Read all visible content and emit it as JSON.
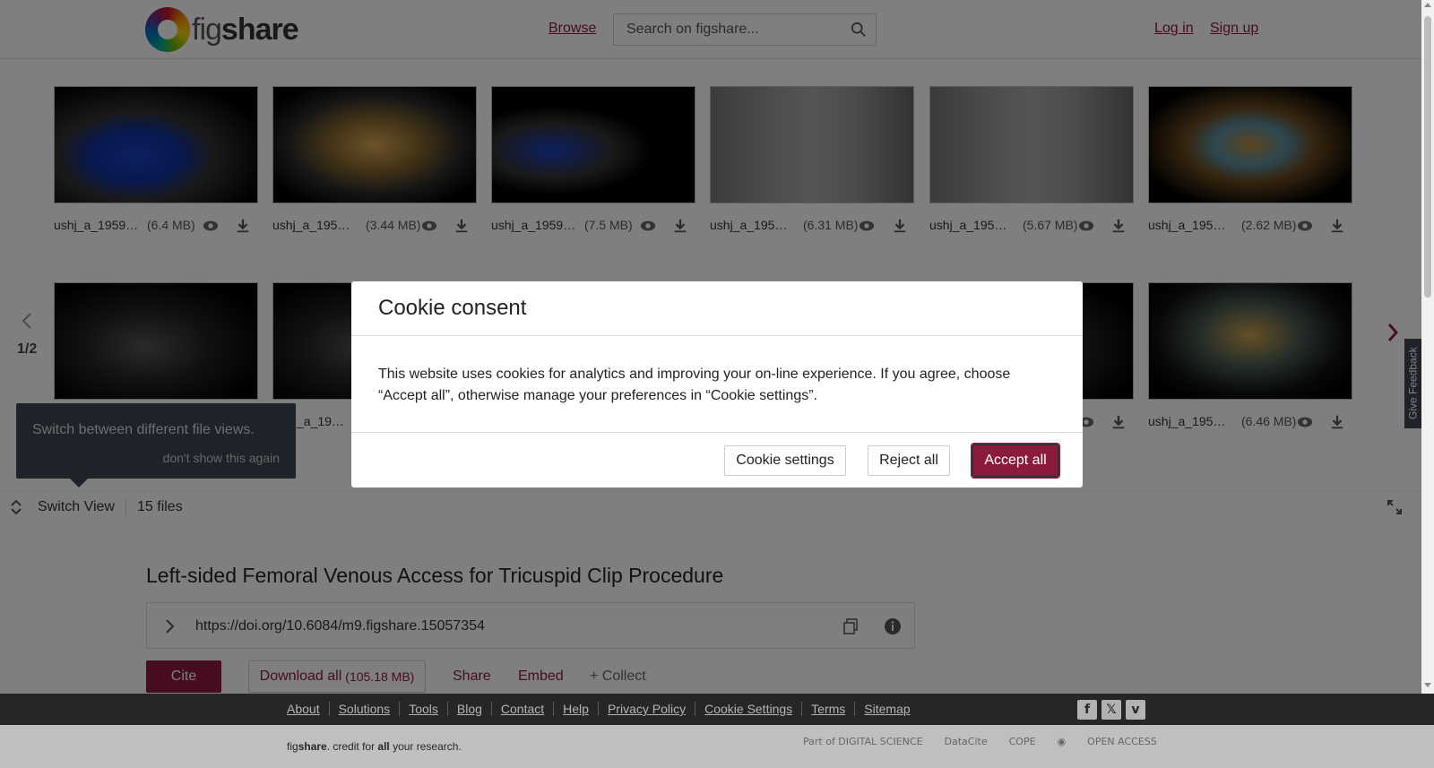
{
  "header": {
    "logo_prefix": "fig",
    "logo_suffix": "share",
    "browse": "Browse",
    "search_placeholder": "Search on figshare...",
    "login": "Log in",
    "signup": "Sign up"
  },
  "gallery": {
    "pager": "1/2",
    "row1": [
      {
        "name": "ushj_a_1959…",
        "size": "(6.4 MB)"
      },
      {
        "name": "ushj_a_195…",
        "size": "(3.44 MB)"
      },
      {
        "name": "ushj_a_1959…",
        "size": "(7.5 MB)"
      },
      {
        "name": "ushj_a_195…",
        "size": "(6.31 MB)"
      },
      {
        "name": "ushj_a_195…",
        "size": "(5.67 MB)"
      },
      {
        "name": "ushj_a_195…",
        "size": "(2.62 MB)"
      }
    ],
    "row2": [
      {
        "name": "",
        "size": ""
      },
      {
        "name": "_a_19…",
        "size": ""
      },
      {
        "name": "ushj_a_195…",
        "size": "(6.46 MB)"
      }
    ],
    "switch_view": "Switch View",
    "files_count": "15 files"
  },
  "tooltip": {
    "text": "Switch between different file views.",
    "dismiss": "don't show this again"
  },
  "item": {
    "title": "Left-sided Femoral Venous Access for Tricuspid Clip Procedure",
    "doi": "https://doi.org/10.6084/m9.figshare.15057354",
    "cite": "Cite",
    "download_all": "Download all",
    "download_size": "(105.18 MB)",
    "share": "Share",
    "embed": "Embed",
    "collect": "+ Collect"
  },
  "footer": {
    "links": [
      "About",
      "Solutions",
      "Tools",
      "Blog",
      "Contact",
      "Help",
      "Privacy Policy",
      "Cookie Settings",
      "Terms",
      "Sitemap"
    ],
    "credit_fig": "fig",
    "credit_share": "share",
    "credit_mid": ". credit for ",
    "credit_all": "all",
    "credit_end": " your research.",
    "partner_ds": "Part of DIGITAL SCIENCE",
    "partner_datacite": "DataCite",
    "partner_cope": "COPE",
    "partner_oa": "OPEN ACCESS"
  },
  "feedback": "Give Feedback",
  "cookie": {
    "title": "Cookie consent",
    "body": "This website uses cookies for analytics and improving your on-line experience. If you agree, choose “Accept all”, otherwise manage your preferences in “Cookie settings”.",
    "settings": "Cookie settings",
    "reject": "Reject all",
    "accept": "Accept all"
  },
  "colors": {
    "brand": "#8b1a3c",
    "tooltip_bg": "#3b4651",
    "footer_bg": "#333333"
  }
}
